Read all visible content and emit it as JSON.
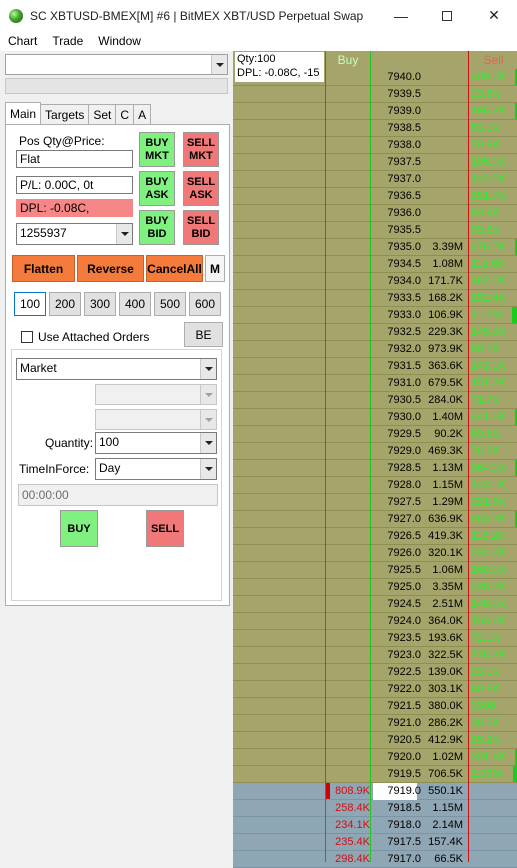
{
  "window": {
    "title": "SC XBTUSD-BMEX[M]  #6 | BitMEX XBT/USD Perpetual Swap",
    "minimize": "—",
    "close": "✕"
  },
  "menu": [
    "Chart",
    "Trade",
    "Window"
  ],
  "left": {
    "tabs": [
      "Main",
      "Targets",
      "Set",
      "C",
      "A"
    ],
    "pos_label": "Pos Qty@Price:",
    "pos_value": "Flat",
    "pl_value": "P/L: 0.00C, 0t",
    "dpl_value": "DPL: -0.08C,",
    "account": "1255937",
    "trade_buttons": {
      "buy_mkt": "BUY MKT",
      "sell_mkt": "SELL MKT",
      "buy_ask": "BUY ASK",
      "sell_ask": "SELL ASK",
      "buy_bid": "BUY BID",
      "sell_bid": "SELL BID"
    },
    "flatten": "Flatten",
    "reverse": "Reverse",
    "cancel_all": "CancelAll",
    "m_button": "M",
    "quantities": [
      "100",
      "200",
      "300",
      "400",
      "500",
      "600"
    ],
    "selected_qty_index": 0,
    "attached_orders_label": "Use Attached Orders",
    "attached_orders_checked": false,
    "be_button": "BE",
    "order_type": "Market",
    "quantity_label": "Quantity:",
    "quantity_value": "100",
    "tif_label": "TimeInForce:",
    "tif_value": "Day",
    "time_value": "00:00:00",
    "buy_button": "BUY",
    "sell_button": "SELL"
  },
  "ladder": {
    "qty_label": "Qty:100",
    "dpl_label": "DPL: -0.08C, -15",
    "buy_header": "Buy",
    "sell_header": "Sell",
    "colors": {
      "bid_bg": "#a5a56b",
      "ask_bg": "#8fa6b5",
      "buy_text": "#d01010",
      "sell_text": "#2ef02e"
    },
    "rows": [
      {
        "price": "7940.0",
        "size": "",
        "sell": "409.2K",
        "sell_bar": 0.1
      },
      {
        "price": "7939.5",
        "size": "",
        "sell": "23.8K",
        "sell_bar": 0
      },
      {
        "price": "7939.0",
        "size": "",
        "sell": "196.2K",
        "sell_bar": 0.05
      },
      {
        "price": "7938.5",
        "size": "",
        "sell": "53.1K",
        "sell_bar": 0
      },
      {
        "price": "7938.0",
        "size": "",
        "sell": "70.3K",
        "sell_bar": 0
      },
      {
        "price": "7937.5",
        "size": "",
        "sell": "105.1K",
        "sell_bar": 0
      },
      {
        "price": "7937.0",
        "size": "",
        "sell": "142.8K",
        "sell_bar": 0
      },
      {
        "price": "7936.5",
        "size": "",
        "sell": "151.7K",
        "sell_bar": 0
      },
      {
        "price": "7936.0",
        "size": "",
        "sell": "93.9K",
        "sell_bar": 0
      },
      {
        "price": "7935.5",
        "size": "",
        "sell": "99.8K",
        "sell_bar": 0
      },
      {
        "price": "7935.0",
        "size": "3.39M",
        "sell": "476.7K",
        "sell_bar": 0.15
      },
      {
        "price": "7934.5",
        "size": "1.08M",
        "sell": "112.6K",
        "sell_bar": 0
      },
      {
        "price": "7934.0",
        "size": "171.7K",
        "sell": "162.0K",
        "sell_bar": 0
      },
      {
        "price": "7933.5",
        "size": "168.2K",
        "sell": "152.4K",
        "sell_bar": 0
      },
      {
        "price": "7933.0",
        "size": "106.9K",
        "sell": "1.12M",
        "sell_bar": 0.6
      },
      {
        "price": "7932.5",
        "size": "229.3K",
        "sell": "145.3K",
        "sell_bar": 0
      },
      {
        "price": "7932.0",
        "size": "973.9K",
        "sell": "99.2K",
        "sell_bar": 0
      },
      {
        "price": "7931.5",
        "size": "363.6K",
        "sell": "143.1K",
        "sell_bar": 0
      },
      {
        "price": "7931.0",
        "size": "679.5K",
        "sell": "151.2K",
        "sell_bar": 0
      },
      {
        "price": "7930.5",
        "size": "284.0K",
        "sell": "71.7K",
        "sell_bar": 0
      },
      {
        "price": "7930.0",
        "size": "1.40M",
        "sell": "441.6K",
        "sell_bar": 0.12
      },
      {
        "price": "7929.5",
        "size": "90.2K",
        "sell": "69.5K",
        "sell_bar": 0
      },
      {
        "price": "7929.0",
        "size": "469.3K",
        "sell": "76.2K",
        "sell_bar": 0
      },
      {
        "price": "7928.5",
        "size": "1.13M",
        "sell": "364.1K",
        "sell_bar": 0.05
      },
      {
        "price": "7928.0",
        "size": "1.15M",
        "sell": "143.1K",
        "sell_bar": 0
      },
      {
        "price": "7927.5",
        "size": "1.29M",
        "sell": "281.6K",
        "sell_bar": 0
      },
      {
        "price": "7927.0",
        "size": "636.9K",
        "sell": "463.3K",
        "sell_bar": 0.12
      },
      {
        "price": "7926.5",
        "size": "419.3K",
        "sell": "118.2K",
        "sell_bar": 0
      },
      {
        "price": "7926.0",
        "size": "320.1K",
        "sell": "234.8K",
        "sell_bar": 0
      },
      {
        "price": "7925.5",
        "size": "1.06M",
        "sell": "160.1K",
        "sell_bar": 0
      },
      {
        "price": "7925.0",
        "size": "3.35M",
        "sell": "338.2K",
        "sell_bar": 0
      },
      {
        "price": "7924.5",
        "size": "2.51M",
        "sell": "148.0K",
        "sell_bar": 0
      },
      {
        "price": "7924.0",
        "size": "364.0K",
        "sell": "153.6K",
        "sell_bar": 0
      },
      {
        "price": "7923.5",
        "size": "193.6K",
        "sell": "72.1K",
        "sell_bar": 0
      },
      {
        "price": "7923.0",
        "size": "322.5K",
        "sell": "178.3K",
        "sell_bar": 0
      },
      {
        "price": "7922.5",
        "size": "139.0K",
        "sell": "23.1K",
        "sell_bar": 0
      },
      {
        "price": "7922.0",
        "size": "303.1K",
        "sell": "60.3K",
        "sell_bar": 0
      },
      {
        "price": "7921.5",
        "size": "380.0K",
        "sell": "3308",
        "sell_bar": 0
      },
      {
        "price": "7921.0",
        "size": "286.2K",
        "sell": "30.5K",
        "sell_bar": 0
      },
      {
        "price": "7920.5",
        "size": "412.9K",
        "sell": "15.2K",
        "sell_bar": 0
      },
      {
        "price": "7920.0",
        "size": "1.02M",
        "sell": "201.9K",
        "sell_bar": 0.05
      },
      {
        "price": "7919.5",
        "size": "706.5K",
        "sell": "1.06M",
        "sell_bar": 0.55
      },
      {
        "price": "7919.0",
        "size": "550.1K",
        "buy": "808.9K",
        "buy_bar": 1,
        "ask": true,
        "highlight": true
      },
      {
        "price": "7918.5",
        "size": "1.15M",
        "buy": "258.4K",
        "ask": true
      },
      {
        "price": "7918.0",
        "size": "2.14M",
        "buy": "234.1K",
        "ask": true
      },
      {
        "price": "7917.5",
        "size": "157.4K",
        "buy": "235.4K",
        "ask": true
      },
      {
        "price": "7917.0",
        "size": "66.5K",
        "buy": "298.4K",
        "ask": true
      }
    ]
  }
}
